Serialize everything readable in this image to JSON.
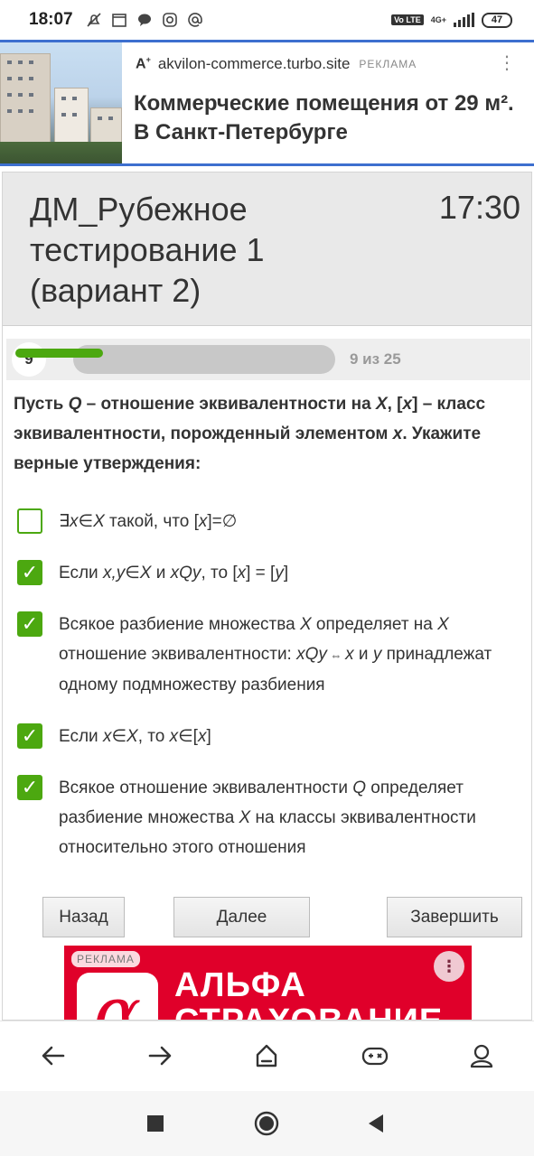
{
  "status_bar": {
    "time": "18:07",
    "network": "4G+",
    "volte": "Vo LTE",
    "battery": "47"
  },
  "top_ad": {
    "domain": "akvilon-commerce.turbo.site",
    "label": "РЕКЛАМА",
    "headline": "Коммерческие помещения от 29 м². В Санкт-Петербурге"
  },
  "quiz": {
    "title": "ДМ_Рубежное тестирование 1 (вариант 2)",
    "timer": "17:30",
    "question_number": "9",
    "progress_text": "9 из 25",
    "progress_fraction": 0.36,
    "question_parts": {
      "p1": "Пусть ",
      "q": "Q",
      "p2": " – отношение эквивалентности на ",
      "x": "X",
      "p3": ", [",
      "xs": "x",
      "p4": "] – класс эквивалентности, порожденный элементом ",
      "xs2": "x",
      "p5": ". Укажите верные утверждения:"
    },
    "options": [
      {
        "checked": false,
        "parts": {
          "a": "∃",
          "b": "x",
          "c": "∈",
          "d": "X",
          "e": " такой, что [",
          "f": "x",
          "g": "]=∅"
        }
      },
      {
        "checked": true,
        "parts": {
          "a": "Если ",
          "b": "x,y",
          "c": "∈",
          "d": "X",
          "e": " и ",
          "f": "xQy",
          "g": ", то [",
          "h": "x",
          "i": "] = [",
          "j": "y",
          "k": "]"
        }
      },
      {
        "checked": true,
        "parts": {
          "a": "Всякое разбиение множества ",
          "b": "X",
          "c": " определяет на ",
          "d": "X",
          "e": " отношение эквивалентности: ",
          "f": "xQy",
          "g": " ⇔ ",
          "h": "x",
          "i": " и ",
          "j": "y",
          "k": " принадлежат одному подмножеству разбиения"
        }
      },
      {
        "checked": true,
        "parts": {
          "a": "Если ",
          "b": "x",
          "c": "∈",
          "d": "X",
          "e": ", то ",
          "f": "x",
          "g": "∈[",
          "h": "x",
          "i": "]"
        }
      },
      {
        "checked": true,
        "parts": {
          "a": "Всякое отношение эквивалентности ",
          "b": "Q",
          "c": " определяет разбиение множества ",
          "d": "X",
          "e": " на классы эквивалентности относительно этого отношения"
        }
      }
    ],
    "buttons": {
      "back": "Назад",
      "next": "Далее",
      "finish": "Завершить"
    }
  },
  "bottom_ad": {
    "label": "РЕКЛАМА",
    "brand_mark": "α",
    "brand_line1": "АЛЬФА",
    "brand_line2": "СТРАХОВАНИЕ",
    "menu": "⋮"
  },
  "browser_bar": {
    "icons": [
      "back-arrow-icon",
      "forward-arrow-icon",
      "home-icon",
      "games-icon",
      "profile-icon"
    ]
  },
  "system_nav": {
    "icons": [
      "recents-square-icon",
      "home-circle-icon",
      "back-triangle-icon"
    ]
  },
  "colors": {
    "accent_green": "#4ca810",
    "ad_border_blue": "#3d6fcf",
    "alfa_red": "#e0002a",
    "header_gray": "#e9e9e9"
  }
}
